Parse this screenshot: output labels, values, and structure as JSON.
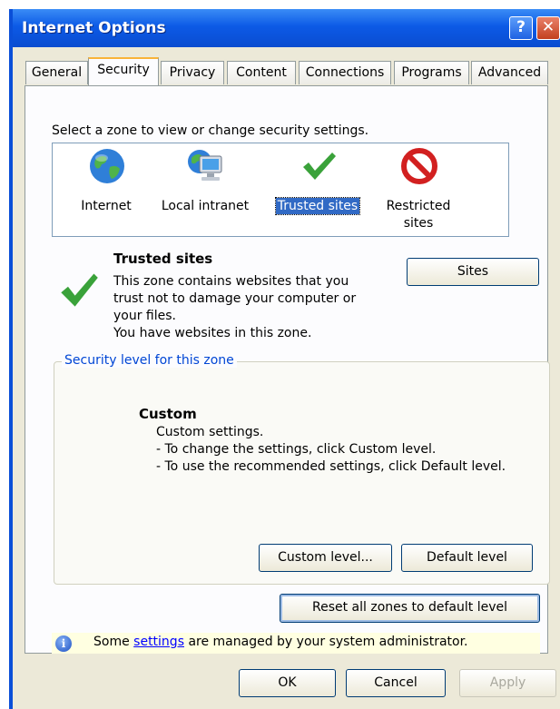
{
  "window": {
    "title": "Internet Options",
    "help_glyph": "?",
    "close_glyph": "✕"
  },
  "tabs": [
    {
      "label": "General"
    },
    {
      "label": "Security"
    },
    {
      "label": "Privacy"
    },
    {
      "label": "Content"
    },
    {
      "label": "Connections"
    },
    {
      "label": "Programs"
    },
    {
      "label": "Advanced"
    }
  ],
  "active_tab": "Security",
  "security": {
    "instruction": "Select a zone to view or change security settings.",
    "zones": [
      {
        "label": "Internet",
        "icon": "globe-icon"
      },
      {
        "label": "Local intranet",
        "icon": "intranet-computer-icon"
      },
      {
        "label": "Trusted sites",
        "icon": "checkmark-icon",
        "selected": true
      },
      {
        "label_line1": "Restricted",
        "label_line2": "sites",
        "icon": "restricted-sign-icon"
      }
    ],
    "zone_detail": {
      "title": "Trusted sites",
      "line1": "This zone contains websites that you",
      "line2": "trust not to damage your computer or",
      "line3": "your files.",
      "line4": "You have websites in this zone.",
      "sites_button": "Sites"
    },
    "level_group": {
      "title": "Security level for this zone",
      "level_name": "Custom",
      "line1": "Custom settings.",
      "line2": "- To change the settings, click Custom level.",
      "line3": "- To use the recommended settings, click Default level.",
      "custom_button": "Custom level...",
      "default_button": "Default level"
    },
    "reset_button": "Reset all zones to default level",
    "info": {
      "prefix": "Some ",
      "link": "settings",
      "suffix": " are managed by your system administrator."
    }
  },
  "footer": {
    "ok": "OK",
    "cancel": "Cancel",
    "apply": "Apply"
  },
  "colors": {
    "title_bar": "#0c5ae6",
    "selection": "#316ac5",
    "check_green": "#3aa23a",
    "restricted_red": "#d22020",
    "info_bar": "#ffffe1"
  }
}
